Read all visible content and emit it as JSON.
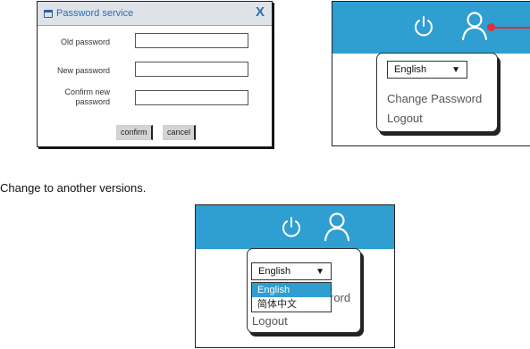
{
  "dialog": {
    "title": "Password service",
    "close_label": "X",
    "fields": [
      {
        "label": "Old password"
      },
      {
        "label": "New password"
      },
      {
        "label": "Confirm new password"
      }
    ],
    "confirm_label": "confirm",
    "cancel_label": "cancel"
  },
  "user_menu": {
    "language_selected": "English",
    "dropdown_arrow": "▼",
    "change_password_label": "Change Password",
    "logout_label": "Logout"
  },
  "caption": "Change to another versions.",
  "language_dropdown": {
    "selected": "English",
    "arrow": "▼",
    "options": [
      "English",
      "简体中文"
    ],
    "partial_item_text": "rord",
    "logout_label": "Logout"
  },
  "colors": {
    "header_blue": "#2f9ed1",
    "title_blue": "#2a6db5",
    "indicator_red": "#e0303a",
    "button_gray": "#d4d4d4"
  },
  "icons": [
    "password-dialog-icon",
    "close-icon",
    "power-icon",
    "user-icon",
    "dropdown-arrow-icon"
  ]
}
